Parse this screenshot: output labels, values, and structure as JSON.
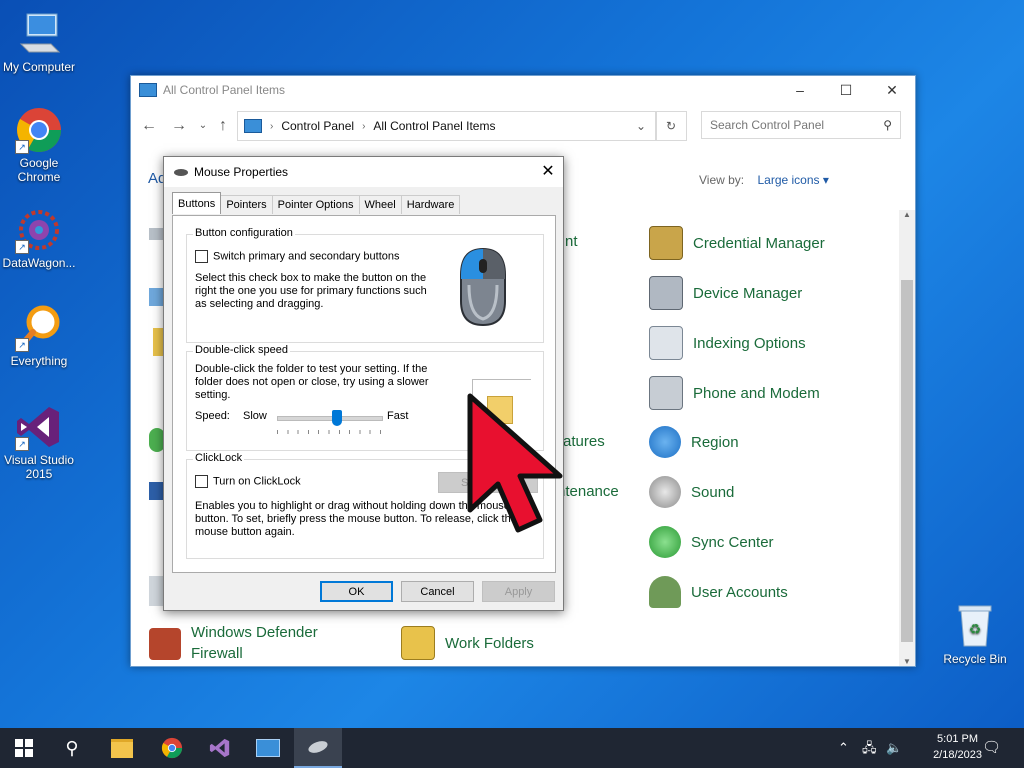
{
  "desktop": {
    "icons": [
      {
        "label": "My Computer"
      },
      {
        "label": "Google Chrome"
      },
      {
        "label": "DataWagon..."
      },
      {
        "label": "Everything"
      },
      {
        "label": "Visual Studio 2015"
      },
      {
        "label": "Recycle Bin"
      }
    ]
  },
  "control_panel": {
    "title": "All Control Panel Items",
    "breadcrumb": [
      "Control Panel",
      "All Control Panel Items"
    ],
    "search_placeholder": "Search Control Panel",
    "adjust_partial": "Ad",
    "view_by_label": "View by:",
    "view_by_value": "Large icons",
    "items": [
      {
        "label": "Credential Manager",
        "icon": "credential-manager-icon"
      },
      {
        "label": "Device Manager",
        "icon": "device-manager-icon"
      },
      {
        "label": "Indexing Options",
        "icon": "indexing-options-icon"
      },
      {
        "label": "Phone and Modem",
        "icon": "phone-modem-icon"
      },
      {
        "label": "Region",
        "icon": "region-icon"
      },
      {
        "label": "Sound",
        "icon": "sound-icon"
      },
      {
        "label": "Sync Center",
        "icon": "sync-center-icon"
      },
      {
        "label": "User Accounts",
        "icon": "user-accounts-icon"
      },
      {
        "label": "Windows Defender Firewall",
        "icon": "firewall-icon"
      },
      {
        "label": "Work Folders",
        "icon": "work-folders-icon"
      }
    ],
    "partial_labels": [
      "nt",
      "atures",
      "ntenance"
    ]
  },
  "mouse_dialog": {
    "title": "Mouse Properties",
    "tabs": [
      "Buttons",
      "Pointers",
      "Pointer Options",
      "Wheel",
      "Hardware"
    ],
    "button_config": {
      "group_label": "Button configuration",
      "switch_label": "Switch primary and secondary buttons",
      "description": "Select this check box to make the button on the right the one you use for primary functions such as selecting and dragging."
    },
    "double_click": {
      "group_label": "Double-click speed",
      "description": "Double-click the folder to test your setting. If the folder does not open or close, try using a slower setting.",
      "speed_label": "Speed:",
      "slow_label": "Slow",
      "fast_label": "Fast",
      "speed_fraction": 0.58
    },
    "clicklock": {
      "group_label": "ClickLock",
      "turn_on_label": "Turn on ClickLock",
      "settings_label": "Se",
      "description": "Enables you to highlight or drag without holding down the mouse button. To set, briefly press the mouse button. To release, click the mouse button again."
    },
    "ok_label": "OK",
    "cancel_label": "Cancel",
    "apply_label": "Apply"
  },
  "taskbar": {
    "time": "5:01 PM",
    "date": "2/18/2023"
  }
}
